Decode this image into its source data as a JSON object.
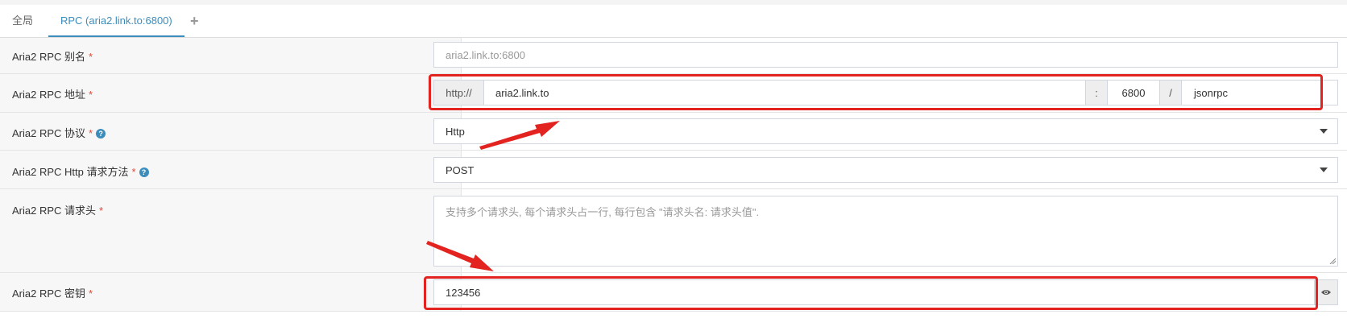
{
  "tabs": {
    "global_label": "全局",
    "rpc_label": "RPC (aria2.link.to:6800)",
    "add_label": "+"
  },
  "rows": {
    "alias": {
      "label": "Aria2 RPC 别名",
      "placeholder": "aria2.link.to:6800"
    },
    "address": {
      "label": "Aria2 RPC 地址",
      "protocol_prefix": "http://",
      "host": "aria2.link.to",
      "colon": ":",
      "port": "6800",
      "slash": "/",
      "path": "jsonrpc"
    },
    "protocol": {
      "label": "Aria2 RPC 协议",
      "selected": "Http"
    },
    "method": {
      "label": "Aria2 RPC Http 请求方法",
      "selected": "POST"
    },
    "headers": {
      "label": "Aria2 RPC 请求头",
      "placeholder": "支持多个请求头, 每个请求头占一行, 每行包含 \"请求头名: 请求头值\"."
    },
    "secret": {
      "label": "Aria2 RPC 密钥",
      "value": "123456"
    }
  },
  "required_mark": "*",
  "colors": {
    "accent": "#3c8dbc",
    "required": "#dd4b39",
    "annotation": "#e3231f"
  },
  "icons": {
    "help": "question-circle-icon",
    "eye": "eye-icon",
    "dropdown": "caret-down-icon"
  }
}
